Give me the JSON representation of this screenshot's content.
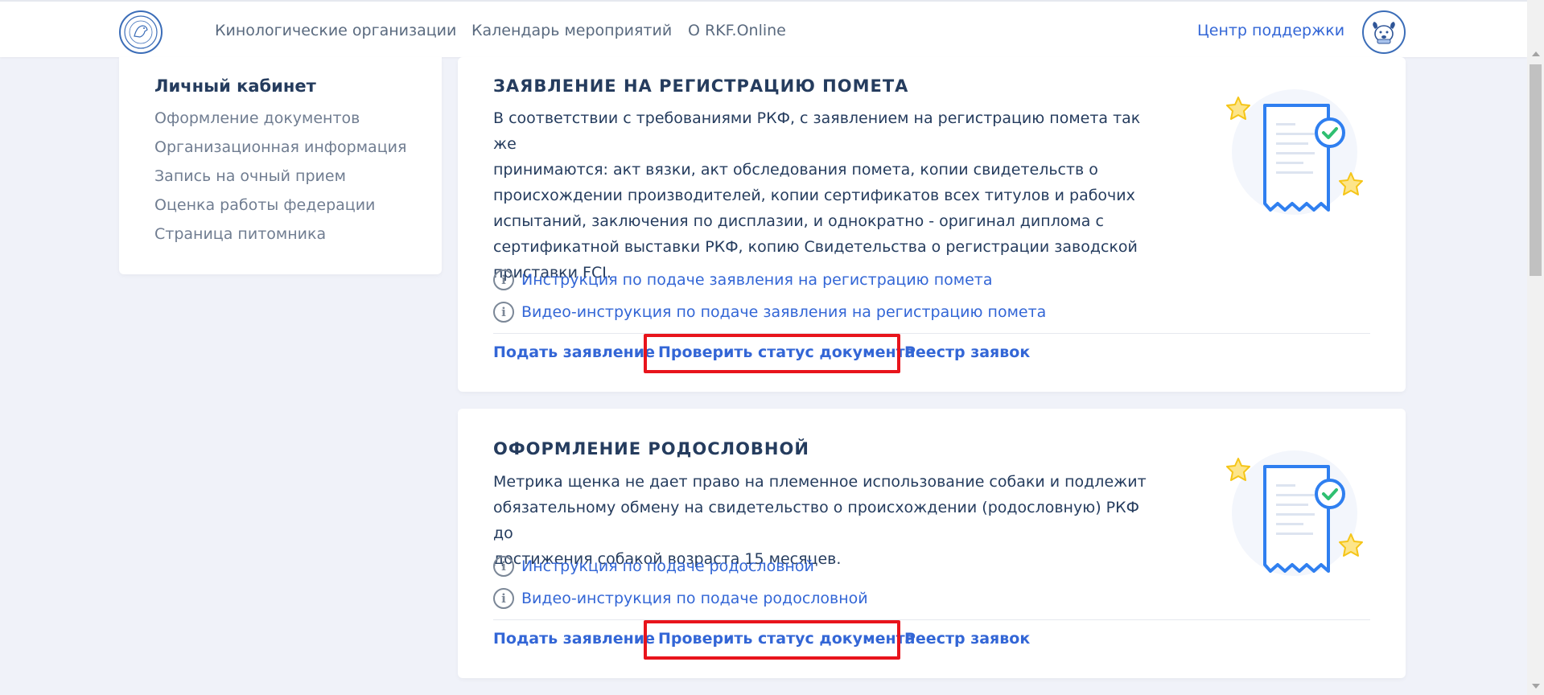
{
  "header": {
    "nav": [
      {
        "label": "Кинологические организации"
      },
      {
        "label": "Календарь мероприятий"
      },
      {
        "label": "О RKF.Online"
      }
    ],
    "support_label": "Центр поддержки"
  },
  "sidebar": {
    "title": "Личный кабинет",
    "items": [
      {
        "label": "Оформление документов"
      },
      {
        "label": "Организационная информация"
      },
      {
        "label": "Запись на очный прием"
      },
      {
        "label": "Оценка работы федерации"
      },
      {
        "label": "Страница питомника"
      }
    ]
  },
  "cards": [
    {
      "title": "ЗАЯВЛЕНИЕ НА РЕГИСТРАЦИЮ ПОМЕТА",
      "description_lines": [
        "В соответствии с требованиями РКФ, с заявлением на регистрацию помета так же",
        "принимаются: акт вязки, акт обследования помета, копии свидетельств о",
        "происхождении производителей, копии сертификатов всех титулов и рабочих",
        "испытаний, заключения по дисплазии, и однократно - оригинал диплома с",
        "сертификатной выставки РКФ, копию Свидетельства о регистрации заводской",
        "приставки FCI."
      ],
      "links": [
        {
          "label": "Инструкция по подаче заявления на регистрацию помета"
        },
        {
          "label": "Видео-инструкция по подаче заявления на регистрацию помета"
        }
      ],
      "actions": {
        "submit": "Подать заявление",
        "check_status": "Проверить статус документа",
        "registry": "Реестр заявок"
      }
    },
    {
      "title": "ОФОРМЛЕНИЕ РОДОСЛОВНОЙ",
      "description_lines": [
        "Метрика щенка не дает право на племенное использование собаки и подлежит",
        "обязательному обмену на свидетельство о происхождении (родословную) РКФ до",
        "достижения собакой возраста 15 месяцев."
      ],
      "links": [
        {
          "label": "Инструкция по подаче родословной"
        },
        {
          "label": "Видео-инструкция по подаче родословной"
        }
      ],
      "actions": {
        "submit": "Подать заявление",
        "check_status": "Проверить статус документа",
        "registry": "Реестр заявок"
      }
    }
  ],
  "icons": {
    "info": "i",
    "logo": "rkf-logo-icon",
    "avatar": "dog-avatar-icon",
    "document": "document-check-icon"
  },
  "colors": {
    "accent": "#3366d6",
    "highlight": "#e8141c",
    "background": "#f0f2f9",
    "star": "#f5d63a"
  }
}
